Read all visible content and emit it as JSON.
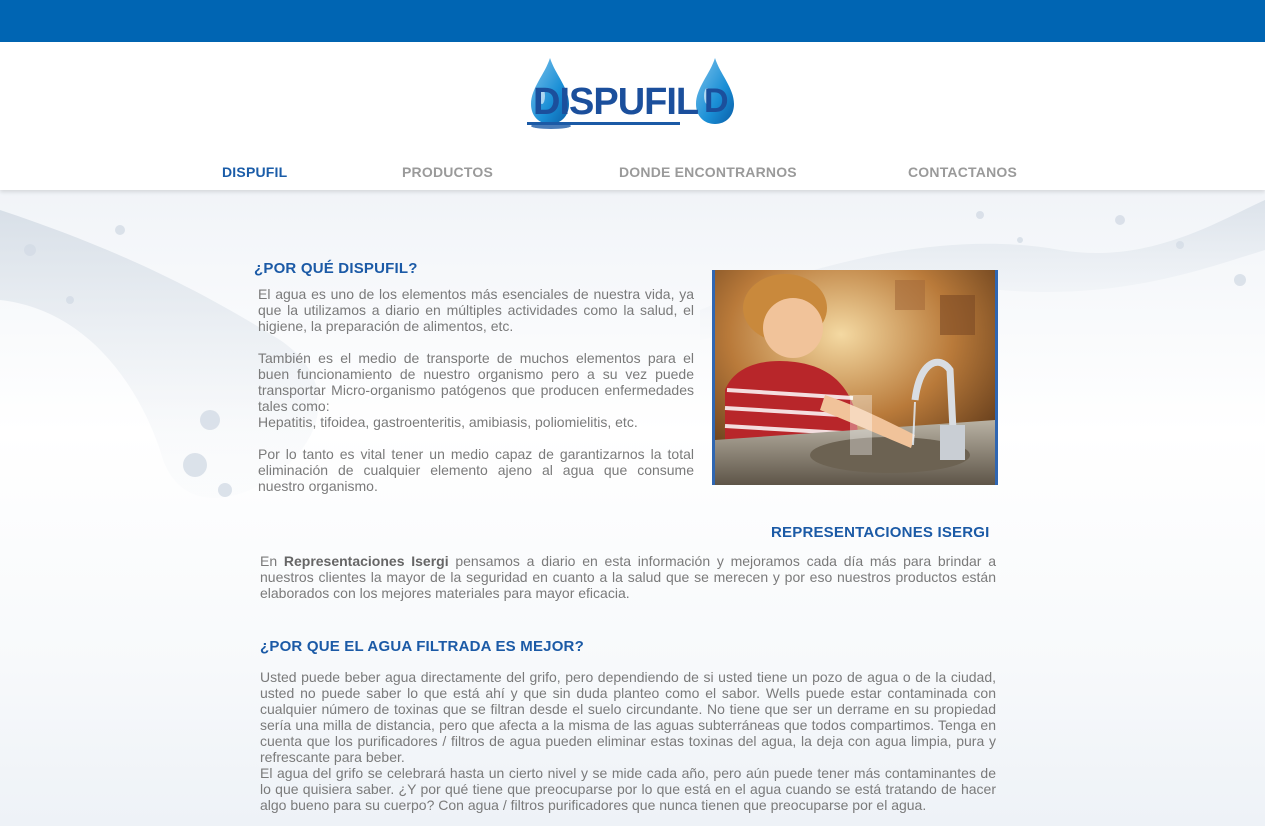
{
  "colors": {
    "topbar": "#0065b3",
    "brand_blue": "#1b5aa6",
    "nav_active": "#1a5ca8",
    "nav_inactive": "#9a9a9a",
    "text": "#7a7a7a"
  },
  "logo": {
    "text": "DISPUFIL",
    "mark": "D"
  },
  "nav": {
    "items": [
      {
        "label": "DISPUFIL",
        "active": true
      },
      {
        "label": "PRODUCTOS",
        "active": false
      },
      {
        "label": "DONDE ENCONTRARNOS",
        "active": false
      },
      {
        "label": "CONTACTANOS",
        "active": false
      }
    ]
  },
  "section1": {
    "title": "¿POR QUÉ DISPUFIL?",
    "p1": "El agua es uno de los elementos más esenciales de nuestra vida, ya que la utilizamos a diario en múltiples actividades como la salud, el higiene, la preparación de alimentos, etc.",
    "p2a": "También es el medio de transporte de muchos elementos  para el buen funcionamiento de nuestro organismo pero a su vez puede transportar Micro-organismo patógenos que producen enfermedades tales como:",
    "p2b": "Hepatitis, tifoidea, gastroenteritis, amibiasis, poliomielitis, etc.",
    "p3": "Por lo tanto es vital tener un medio capaz de garantizarnos la total eliminación de cualquier elemento ajeno al agua que consume nuestro organismo."
  },
  "photo": {
    "icon": "child-at-faucet-photo"
  },
  "section2": {
    "title": "REPRESENTACIONES ISERGI",
    "pre": "En ",
    "bold": "Representaciones Isergi",
    "post": " pensamos a diario en esta información y mejoramos cada día más para brindar a nuestros clientes la mayor de la seguridad en cuanto a la salud que se merecen y por eso nuestros productos están elaborados con los mejores materiales para mayor eficacia."
  },
  "section3": {
    "title": "¿POR QUE EL AGUA FILTRADA ES MEJOR?",
    "p1": "Usted puede beber agua directamente del grifo, pero dependiendo de si usted tiene un pozo de agua o de la ciudad, usted no puede saber lo que está ahí y que sin duda planteo como el sabor. Wells puede estar contaminada con cualquier número de toxinas que se filtran desde el suelo circundante. No tiene que ser un derrame en su propiedad sería una milla de distancia, pero que afecta a la misma de las aguas subterráneas que todos compartimos. Tenga en cuenta que los purificadores / filtros de agua pueden eliminar estas toxinas del agua, la deja con agua limpia, pura y refrescante para beber.",
    "p2": "El agua del grifo se celebrará hasta un cierto nivel y se mide cada año, pero aún puede tener más contaminantes de lo que quisiera saber. ¿Y por qué tiene que preocuparse por lo que está en el agua cuando se está tratando de hacer algo bueno para su cuerpo? Con agua / filtros purificadores que nunca tienen que preocuparse por el agua."
  }
}
